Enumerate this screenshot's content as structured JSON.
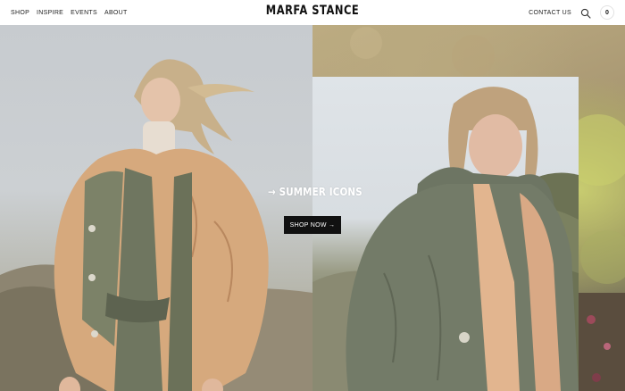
{
  "header": {
    "nav_left": [
      {
        "label": "SHOP"
      },
      {
        "label": "INSPIRE"
      },
      {
        "label": "EVENTS"
      },
      {
        "label": "ABOUT"
      }
    ],
    "logo": "MARFA STANCE",
    "contact_label": "CONTACT US",
    "cart_count": "0"
  },
  "hero": {
    "title": "→ SUMMER ICONS",
    "cta_label": "SHOP NOW →"
  },
  "icons": {
    "search": "search-icon",
    "cart": "bag-count"
  }
}
